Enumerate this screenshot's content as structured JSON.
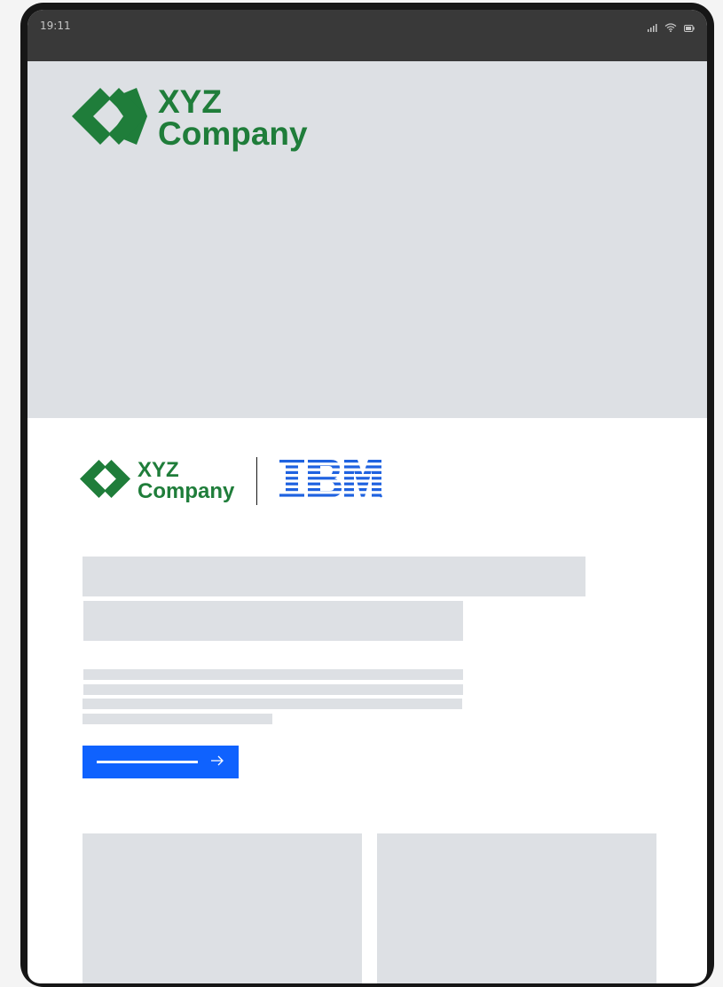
{
  "status_bar": {
    "time": "19:11",
    "icons": [
      "signal-icon",
      "wifi-icon",
      "battery-icon"
    ]
  },
  "hero": {
    "logo": {
      "line1": "XYZ",
      "line2": "Company",
      "icon": "diamond-logo-icon"
    }
  },
  "cobrand": {
    "partner_logo": {
      "line1": "XYZ",
      "line2": "Company"
    },
    "ibm_logo": "IBM"
  },
  "cta": {
    "icon": "arrow-right-icon"
  },
  "colors": {
    "brand_green": "#1f7d3a",
    "ibm_blue": "#0f62fe",
    "placeholder_gray": "#dde0e4",
    "status_bar": "#393939"
  }
}
